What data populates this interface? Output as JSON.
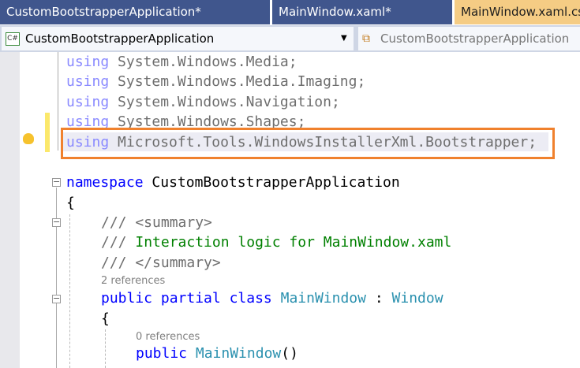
{
  "tabs": [
    {
      "label": "CustomBootstrapperApplication*"
    },
    {
      "label": "MainWindow.xaml*"
    },
    {
      "label": "MainWindow.xaml.cs"
    }
  ],
  "nav": {
    "project": "CustomBootstrapperApplication",
    "project_icon": "C#",
    "class": "CustomBootstrapperApplication"
  },
  "code": {
    "using_kw": "using",
    "u1": "System.Windows.Media;",
    "u2": "System.Windows.Media.Imaging;",
    "u3": "System.Windows.Navigation;",
    "u4": "System.Windows.Shapes;",
    "u5": "Microsoft.Tools.WindowsInstallerXml.Bootstrapper;",
    "ns_kw": "namespace",
    "ns_name": "CustomBootstrapperApplication",
    "open_brace": "{",
    "c1": "/// <summary>",
    "c2_prefix": "///",
    "c2": "Interaction logic for MainWindow.xaml",
    "c3": "/// </summary>",
    "refs1": "2 references",
    "public": "public",
    "partial": "partial",
    "class": "class",
    "class_name": "MainWindow",
    "colon": ":",
    "base": "Window",
    "refs2": "0 references",
    "ctor": "MainWindow",
    "ctor_parens": "()"
  },
  "colors": {
    "highlight": "#f0812d",
    "tab_bg": "#40568d",
    "active_tab": "#f5cc84"
  }
}
